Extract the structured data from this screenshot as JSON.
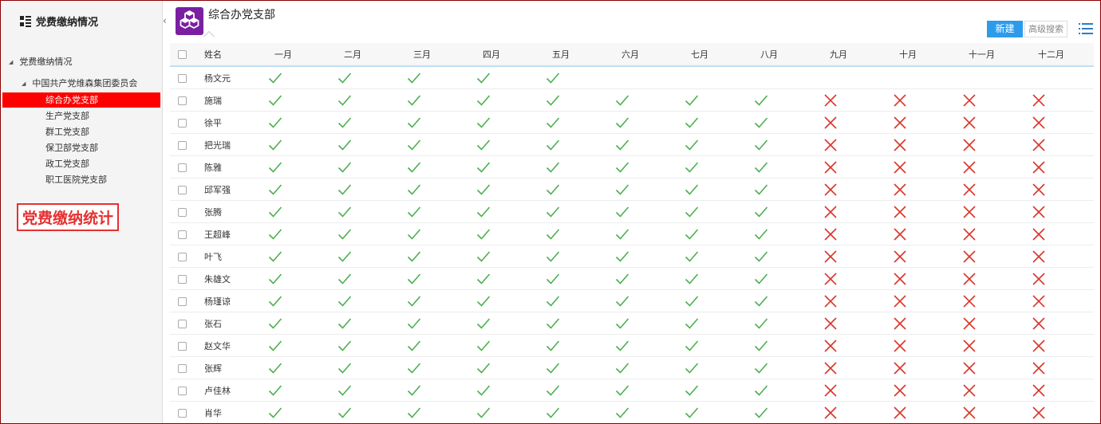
{
  "sidebar": {
    "title": "党费缴纳情况",
    "root": "党费缴纳情况",
    "org": "中国共产党维森集团委员会",
    "branches": [
      "综合办党支部",
      "生产党支部",
      "群工党支部",
      "保卫部党支部",
      "政工党支部",
      "职工医院党支部"
    ],
    "active_index": 0,
    "stat_label": "党费缴纳统计"
  },
  "main": {
    "title": "综合办党支部",
    "new_button": "新建",
    "advanced_search": "高级搜索"
  },
  "table": {
    "name_header": "姓名",
    "months": [
      "一月",
      "二月",
      "三月",
      "四月",
      "五月",
      "六月",
      "七月",
      "八月",
      "九月",
      "十月",
      "十一月",
      "十二月"
    ],
    "rows": [
      {
        "name": "杨文元",
        "status": [
          "paid",
          "paid",
          "paid",
          "paid",
          "paid",
          "",
          "",
          "",
          "",
          "",
          "",
          ""
        ]
      },
      {
        "name": "施瑞",
        "status": [
          "paid",
          "paid",
          "paid",
          "paid",
          "paid",
          "paid",
          "paid",
          "paid",
          "unpaid",
          "unpaid",
          "unpaid",
          "unpaid"
        ]
      },
      {
        "name": "徐平",
        "status": [
          "paid",
          "paid",
          "paid",
          "paid",
          "paid",
          "paid",
          "paid",
          "paid",
          "unpaid",
          "unpaid",
          "unpaid",
          "unpaid"
        ]
      },
      {
        "name": "把光瑞",
        "status": [
          "paid",
          "paid",
          "paid",
          "paid",
          "paid",
          "paid",
          "paid",
          "paid",
          "unpaid",
          "unpaid",
          "unpaid",
          "unpaid"
        ]
      },
      {
        "name": "陈雅",
        "status": [
          "paid",
          "paid",
          "paid",
          "paid",
          "paid",
          "paid",
          "paid",
          "paid",
          "unpaid",
          "unpaid",
          "unpaid",
          "unpaid"
        ]
      },
      {
        "name": "邱军强",
        "status": [
          "paid",
          "paid",
          "paid",
          "paid",
          "paid",
          "paid",
          "paid",
          "paid",
          "unpaid",
          "unpaid",
          "unpaid",
          "unpaid"
        ]
      },
      {
        "name": "张腾",
        "status": [
          "paid",
          "paid",
          "paid",
          "paid",
          "paid",
          "paid",
          "paid",
          "paid",
          "unpaid",
          "unpaid",
          "unpaid",
          "unpaid"
        ]
      },
      {
        "name": "王超峰",
        "status": [
          "paid",
          "paid",
          "paid",
          "paid",
          "paid",
          "paid",
          "paid",
          "paid",
          "unpaid",
          "unpaid",
          "unpaid",
          "unpaid"
        ]
      },
      {
        "name": "叶飞",
        "status": [
          "paid",
          "paid",
          "paid",
          "paid",
          "paid",
          "paid",
          "paid",
          "paid",
          "unpaid",
          "unpaid",
          "unpaid",
          "unpaid"
        ]
      },
      {
        "name": "朱雄文",
        "status": [
          "paid",
          "paid",
          "paid",
          "paid",
          "paid",
          "paid",
          "paid",
          "paid",
          "unpaid",
          "unpaid",
          "unpaid",
          "unpaid"
        ]
      },
      {
        "name": "杨瑾谅",
        "status": [
          "paid",
          "paid",
          "paid",
          "paid",
          "paid",
          "paid",
          "paid",
          "paid",
          "unpaid",
          "unpaid",
          "unpaid",
          "unpaid"
        ]
      },
      {
        "name": "张石",
        "status": [
          "paid",
          "paid",
          "paid",
          "paid",
          "paid",
          "paid",
          "paid",
          "paid",
          "unpaid",
          "unpaid",
          "unpaid",
          "unpaid"
        ]
      },
      {
        "name": "赵文华",
        "status": [
          "paid",
          "paid",
          "paid",
          "paid",
          "paid",
          "paid",
          "paid",
          "paid",
          "unpaid",
          "unpaid",
          "unpaid",
          "unpaid"
        ]
      },
      {
        "name": "张辉",
        "status": [
          "paid",
          "paid",
          "paid",
          "paid",
          "paid",
          "paid",
          "paid",
          "paid",
          "unpaid",
          "unpaid",
          "unpaid",
          "unpaid"
        ]
      },
      {
        "name": "卢佳林",
        "status": [
          "paid",
          "paid",
          "paid",
          "paid",
          "paid",
          "paid",
          "paid",
          "paid",
          "unpaid",
          "unpaid",
          "unpaid",
          "unpaid"
        ]
      },
      {
        "name": "肖华",
        "status": [
          "paid",
          "paid",
          "paid",
          "paid",
          "paid",
          "paid",
          "paid",
          "paid",
          "unpaid",
          "unpaid",
          "unpaid",
          "unpaid"
        ]
      }
    ]
  },
  "icons": {
    "title_icon": "list-tree-icon",
    "logo_icon": "cubes-icon",
    "collapse_icon": "chevron-left-icon",
    "list_view_icon": "list-view-icon",
    "paid_icon": "check-icon",
    "unpaid_icon": "cross-icon"
  },
  "colors": {
    "active_branch": "#ff0000",
    "primary_button": "#2e9bea",
    "paid": "#4caf50",
    "unpaid": "#d9362b",
    "logo_bg": "#7b1fa2"
  }
}
